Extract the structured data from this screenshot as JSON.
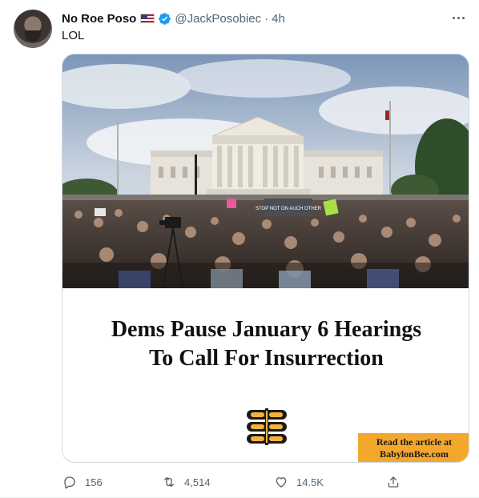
{
  "tweet": {
    "author_name": "No Roe Poso",
    "author_flag_icon": "us-flag-icon",
    "verified_icon": "verified-badge-icon",
    "author_handle": "@JackPosobiec",
    "separator": "·",
    "timestamp": "4h",
    "text": "LOL"
  },
  "media": {
    "headline_line1": "Dems Pause January 6 Hearings",
    "headline_line2": "To Call For Insurrection",
    "protest_sign": "STOP NOT ON AUCH OTHER",
    "cta_line1": "Read the article at",
    "cta_line2": "BabylonBee.com"
  },
  "actions": {
    "replies": "156",
    "retweets": "4,514",
    "likes": "14.5K"
  },
  "colors": {
    "text_primary": "#0f1419",
    "text_secondary": "#536471",
    "verified_blue": "#1d9bf0",
    "cta_orange": "#f3a72c",
    "border": "#cfd9de"
  }
}
